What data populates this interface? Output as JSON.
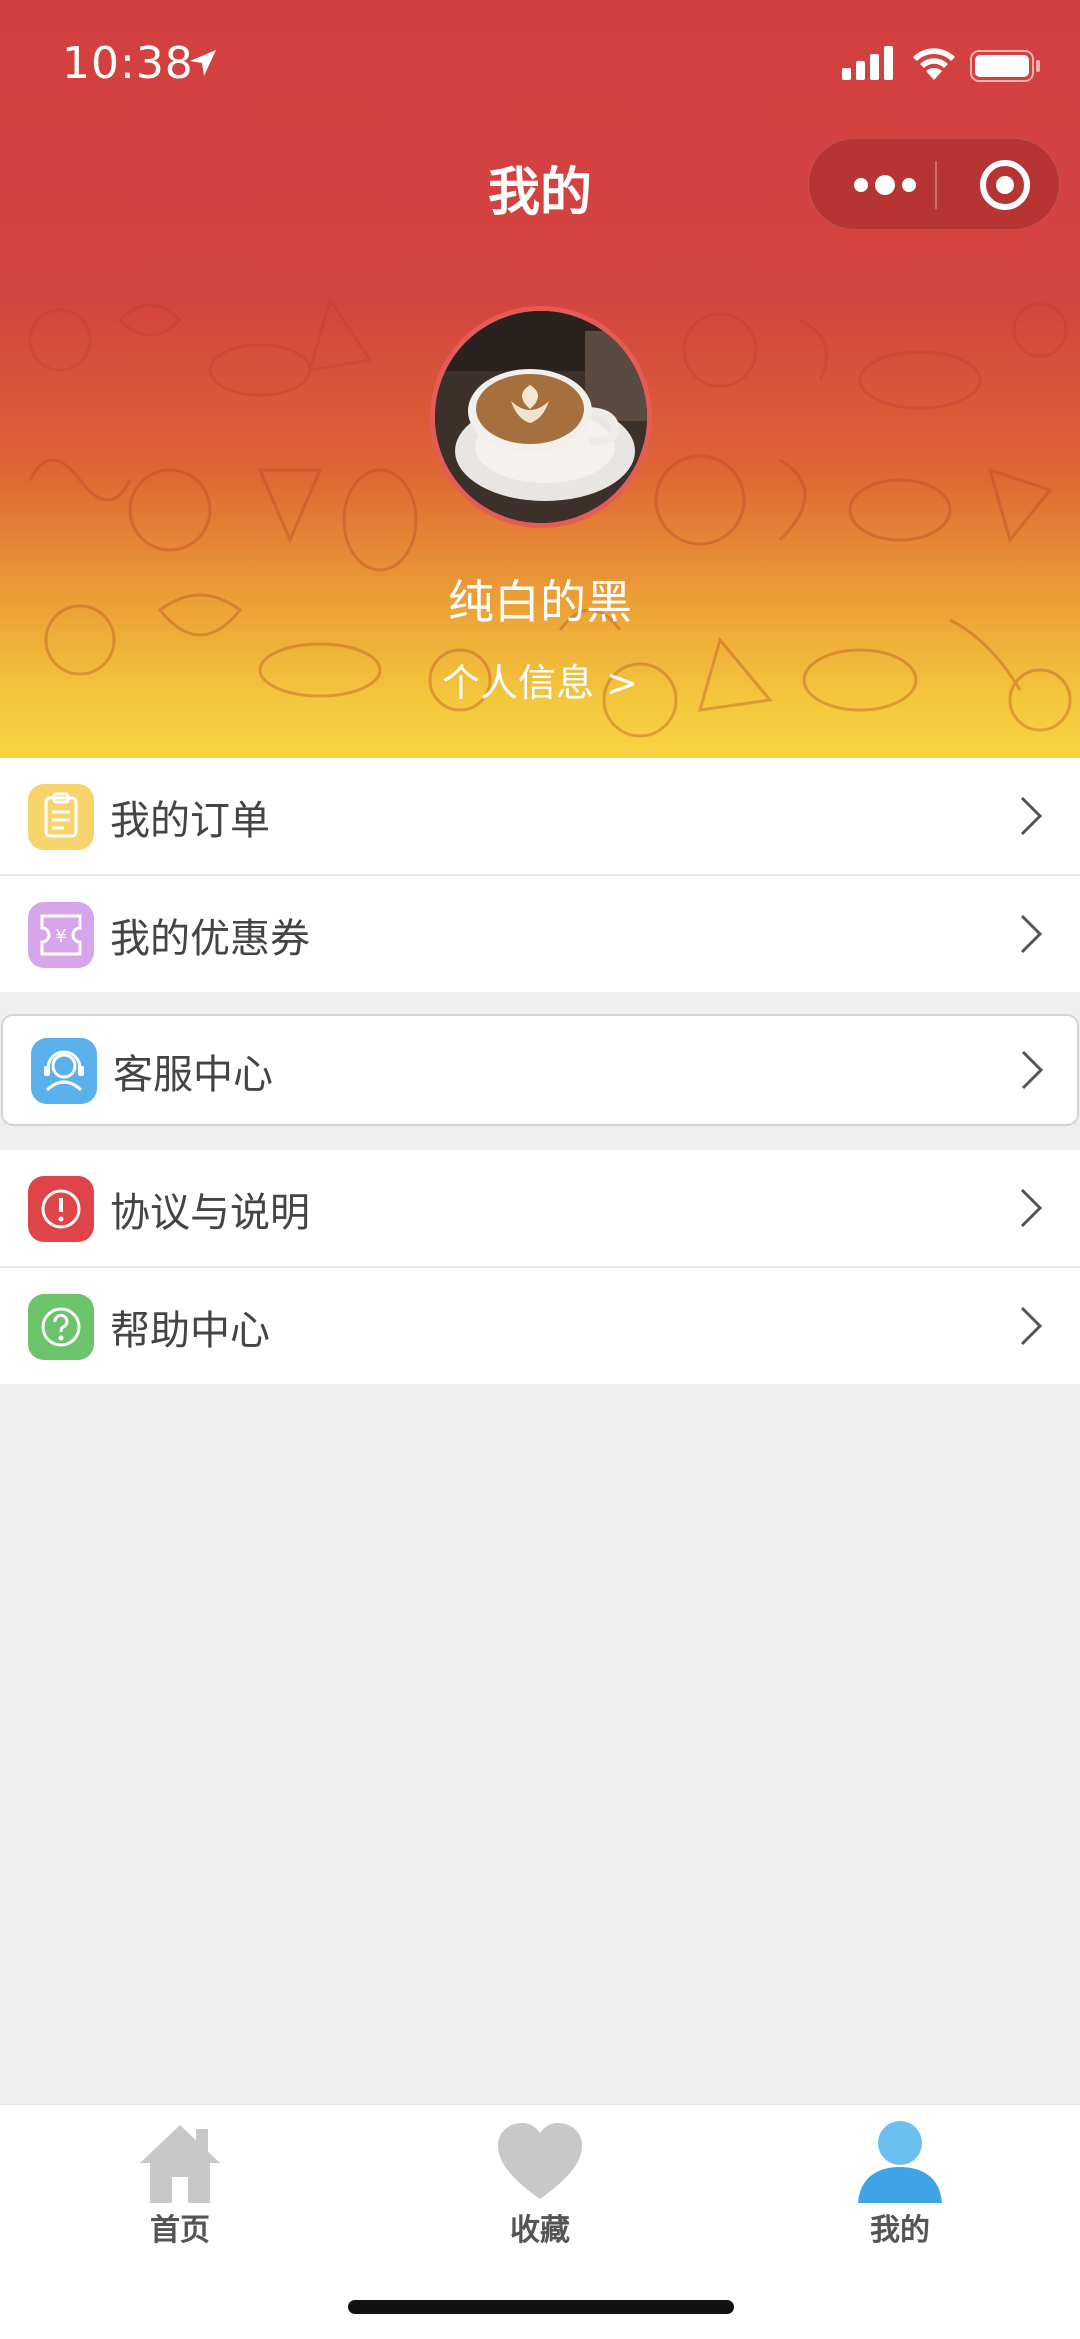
{
  "status_bar": {
    "time": "10:38"
  },
  "nav": {
    "title": "我的"
  },
  "profile": {
    "username": "纯白的黑",
    "info_link": "个人信息 >"
  },
  "menu": {
    "orders": {
      "label": "我的订单",
      "icon": "clipboard-icon",
      "color": "#f7d36b"
    },
    "coupons": {
      "label": "我的优惠券",
      "icon": "coupon-icon",
      "color": "#d7a6ea"
    },
    "service": {
      "label": "客服中心",
      "icon": "customer-service-icon",
      "color": "#5ab0ea"
    },
    "agreement": {
      "label": "协议与说明",
      "icon": "alert-icon",
      "color": "#de4448"
    },
    "help": {
      "label": "帮助中心",
      "icon": "question-icon",
      "color": "#6cc46a"
    }
  },
  "tabbar": {
    "tabs": [
      {
        "label": "首页",
        "icon": "home-icon",
        "active": false
      },
      {
        "label": "收藏",
        "icon": "heart-icon",
        "active": false
      },
      {
        "label": "我的",
        "icon": "user-icon",
        "active": true
      }
    ],
    "inactive_color": "#c8c8c8",
    "active_color": "#4aa8e8"
  },
  "colors": {
    "header_top": "#d23f3f",
    "header_bottom": "#f7d443",
    "background": "#efefef"
  }
}
